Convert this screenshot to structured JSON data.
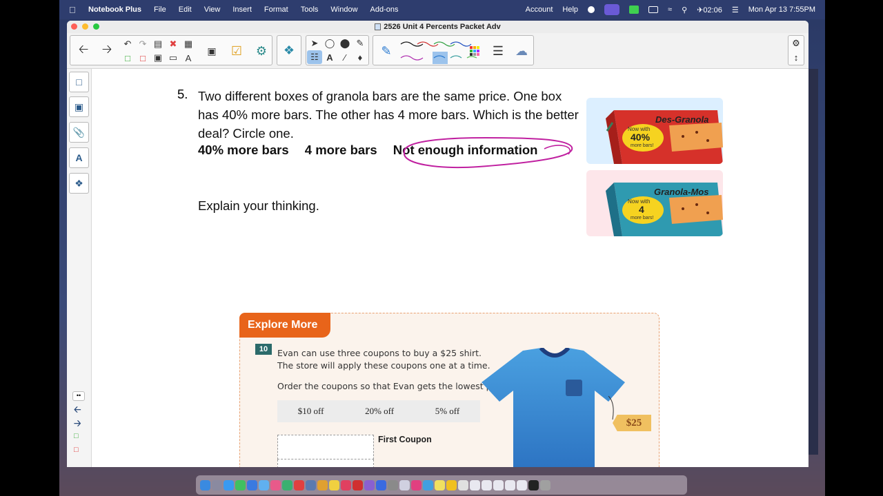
{
  "menubar": {
    "app_name": "Notebook Plus",
    "items": [
      "File",
      "Edit",
      "View",
      "Insert",
      "Format",
      "Tools",
      "Window",
      "Add-ons"
    ],
    "account": "Account",
    "help": "Help",
    "timer": "02:06",
    "datetime": "Mon Apr 13  7:55PM"
  },
  "window": {
    "title": "2526 Unit 4 Percents Packet Adv"
  },
  "question": {
    "number": "5.",
    "text": "Two different boxes of granola bars are the same price. One box has 40% more bars. The other has 4 more bars. Which is the better deal? Circle one.",
    "choices": [
      "40% more bars",
      "4 more bars",
      "Not enough  information"
    ],
    "circled_choice": "Not enough  information",
    "explain": "Explain your thinking."
  },
  "box1": {
    "brand": "Des-Granola",
    "line1": "Now with",
    "value": "40%",
    "line3": "more bars!"
  },
  "box2": {
    "brand": "Granola-Mos",
    "line1": "Now with",
    "value": "4",
    "line3": "more bars!"
  },
  "explore": {
    "title": "Explore More",
    "badge": "10",
    "line1": "Evan can use three coupons to buy a $25 shirt.",
    "line2": "The store will apply these coupons one at a time.",
    "line3": "Order the coupons so that Evan gets the lowest price.",
    "coupons": [
      "$10 off",
      "20% off",
      "5% off"
    ],
    "first_coupon_label": "First Coupon",
    "price_tag": "$25"
  },
  "colors": {
    "explore_orange": "#e8641a",
    "circle_ink": "#c020a0",
    "shirt_blue": "#3a8cd0"
  }
}
